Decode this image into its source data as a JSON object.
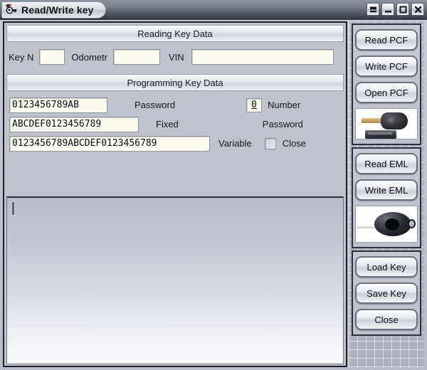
{
  "window": {
    "title": "Read/Write key",
    "icon": "key-app-icon",
    "controls": [
      {
        "name": "shade-button",
        "glyph": "shade"
      },
      {
        "name": "minimize-button",
        "glyph": "minimize"
      },
      {
        "name": "maximize-button",
        "glyph": "maximize"
      },
      {
        "name": "close-button",
        "glyph": "close"
      }
    ]
  },
  "reading_section": {
    "header": "Reading Key Data",
    "fields": [
      {
        "label": "Key N",
        "value": ""
      },
      {
        "label": "Odometr",
        "value": ""
      },
      {
        "label": "VIN",
        "value": ""
      }
    ]
  },
  "programming_section": {
    "header": "Programming Key Data",
    "password": {
      "value": "0123456789AB",
      "label": "Password"
    },
    "fixed": {
      "value": "ABCDEF0123456789",
      "label": "Fixed"
    },
    "variable": {
      "value": "0123456789ABCDEF0123456789",
      "label": "Variable"
    },
    "number": {
      "value": "0",
      "label": "Number"
    },
    "password_close": {
      "line1": "Password",
      "line2": "Close",
      "checked": false
    }
  },
  "log_area": {
    "text": ""
  },
  "sidebar": {
    "group_pcf": {
      "buttons": [
        {
          "label": "Read PCF",
          "name": "read-pcf-button"
        },
        {
          "label": "Write PCF",
          "name": "write-pcf-button"
        },
        {
          "label": "Open PCF",
          "name": "open-pcf-button"
        }
      ],
      "image": "car-key-fob-image"
    },
    "group_eml": {
      "buttons": [
        {
          "label": "Read EML",
          "name": "read-eml-button"
        },
        {
          "label": "Write EML",
          "name": "write-eml-button"
        }
      ],
      "image": "transponder-ring-image"
    },
    "group_file": {
      "buttons": [
        {
          "label": "Load Key",
          "name": "load-key-button"
        },
        {
          "label": "Save Key",
          "name": "save-key-button"
        },
        {
          "label": "Close",
          "name": "close-window-button"
        }
      ]
    }
  },
  "colors": {
    "titlebar_dark": "#31363e",
    "panel_bg": "#c0c3cb",
    "field_bg": "#fbfaf0",
    "border_dark": "#1d2026"
  }
}
